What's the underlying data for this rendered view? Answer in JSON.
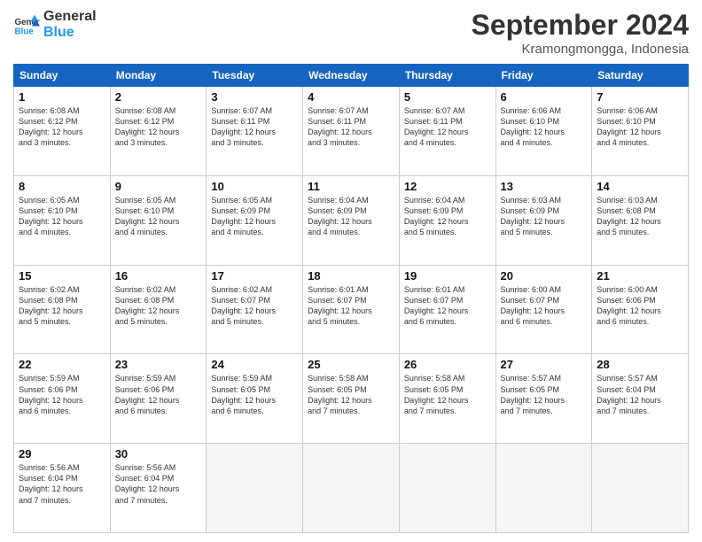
{
  "header": {
    "logo_general": "General",
    "logo_blue": "Blue",
    "title": "September 2024",
    "location": "Kramongmongga, Indonesia"
  },
  "weekdays": [
    "Sunday",
    "Monday",
    "Tuesday",
    "Wednesday",
    "Thursday",
    "Friday",
    "Saturday"
  ],
  "weeks": [
    [
      {
        "day": "1",
        "info": "Sunrise: 6:08 AM\nSunset: 6:12 PM\nDaylight: 12 hours\nand 3 minutes."
      },
      {
        "day": "2",
        "info": "Sunrise: 6:08 AM\nSunset: 6:12 PM\nDaylight: 12 hours\nand 3 minutes."
      },
      {
        "day": "3",
        "info": "Sunrise: 6:07 AM\nSunset: 6:11 PM\nDaylight: 12 hours\nand 3 minutes."
      },
      {
        "day": "4",
        "info": "Sunrise: 6:07 AM\nSunset: 6:11 PM\nDaylight: 12 hours\nand 3 minutes."
      },
      {
        "day": "5",
        "info": "Sunrise: 6:07 AM\nSunset: 6:11 PM\nDaylight: 12 hours\nand 4 minutes."
      },
      {
        "day": "6",
        "info": "Sunrise: 6:06 AM\nSunset: 6:10 PM\nDaylight: 12 hours\nand 4 minutes."
      },
      {
        "day": "7",
        "info": "Sunrise: 6:06 AM\nSunset: 6:10 PM\nDaylight: 12 hours\nand 4 minutes."
      }
    ],
    [
      {
        "day": "8",
        "info": "Sunrise: 6:05 AM\nSunset: 6:10 PM\nDaylight: 12 hours\nand 4 minutes."
      },
      {
        "day": "9",
        "info": "Sunrise: 6:05 AM\nSunset: 6:10 PM\nDaylight: 12 hours\nand 4 minutes."
      },
      {
        "day": "10",
        "info": "Sunrise: 6:05 AM\nSunset: 6:09 PM\nDaylight: 12 hours\nand 4 minutes."
      },
      {
        "day": "11",
        "info": "Sunrise: 6:04 AM\nSunset: 6:09 PM\nDaylight: 12 hours\nand 4 minutes."
      },
      {
        "day": "12",
        "info": "Sunrise: 6:04 AM\nSunset: 6:09 PM\nDaylight: 12 hours\nand 5 minutes."
      },
      {
        "day": "13",
        "info": "Sunrise: 6:03 AM\nSunset: 6:09 PM\nDaylight: 12 hours\nand 5 minutes."
      },
      {
        "day": "14",
        "info": "Sunrise: 6:03 AM\nSunset: 6:08 PM\nDaylight: 12 hours\nand 5 minutes."
      }
    ],
    [
      {
        "day": "15",
        "info": "Sunrise: 6:02 AM\nSunset: 6:08 PM\nDaylight: 12 hours\nand 5 minutes."
      },
      {
        "day": "16",
        "info": "Sunrise: 6:02 AM\nSunset: 6:08 PM\nDaylight: 12 hours\nand 5 minutes."
      },
      {
        "day": "17",
        "info": "Sunrise: 6:02 AM\nSunset: 6:07 PM\nDaylight: 12 hours\nand 5 minutes."
      },
      {
        "day": "18",
        "info": "Sunrise: 6:01 AM\nSunset: 6:07 PM\nDaylight: 12 hours\nand 5 minutes."
      },
      {
        "day": "19",
        "info": "Sunrise: 6:01 AM\nSunset: 6:07 PM\nDaylight: 12 hours\nand 6 minutes."
      },
      {
        "day": "20",
        "info": "Sunrise: 6:00 AM\nSunset: 6:07 PM\nDaylight: 12 hours\nand 6 minutes."
      },
      {
        "day": "21",
        "info": "Sunrise: 6:00 AM\nSunset: 6:06 PM\nDaylight: 12 hours\nand 6 minutes."
      }
    ],
    [
      {
        "day": "22",
        "info": "Sunrise: 5:59 AM\nSunset: 6:06 PM\nDaylight: 12 hours\nand 6 minutes."
      },
      {
        "day": "23",
        "info": "Sunrise: 5:59 AM\nSunset: 6:06 PM\nDaylight: 12 hours\nand 6 minutes."
      },
      {
        "day": "24",
        "info": "Sunrise: 5:59 AM\nSunset: 6:05 PM\nDaylight: 12 hours\nand 6 minutes."
      },
      {
        "day": "25",
        "info": "Sunrise: 5:58 AM\nSunset: 6:05 PM\nDaylight: 12 hours\nand 7 minutes."
      },
      {
        "day": "26",
        "info": "Sunrise: 5:58 AM\nSunset: 6:05 PM\nDaylight: 12 hours\nand 7 minutes."
      },
      {
        "day": "27",
        "info": "Sunrise: 5:57 AM\nSunset: 6:05 PM\nDaylight: 12 hours\nand 7 minutes."
      },
      {
        "day": "28",
        "info": "Sunrise: 5:57 AM\nSunset: 6:04 PM\nDaylight: 12 hours\nand 7 minutes."
      }
    ],
    [
      {
        "day": "29",
        "info": "Sunrise: 5:56 AM\nSunset: 6:04 PM\nDaylight: 12 hours\nand 7 minutes."
      },
      {
        "day": "30",
        "info": "Sunrise: 5:56 AM\nSunset: 6:04 PM\nDaylight: 12 hours\nand 7 minutes."
      },
      {
        "day": "",
        "info": ""
      },
      {
        "day": "",
        "info": ""
      },
      {
        "day": "",
        "info": ""
      },
      {
        "day": "",
        "info": ""
      },
      {
        "day": "",
        "info": ""
      }
    ]
  ]
}
